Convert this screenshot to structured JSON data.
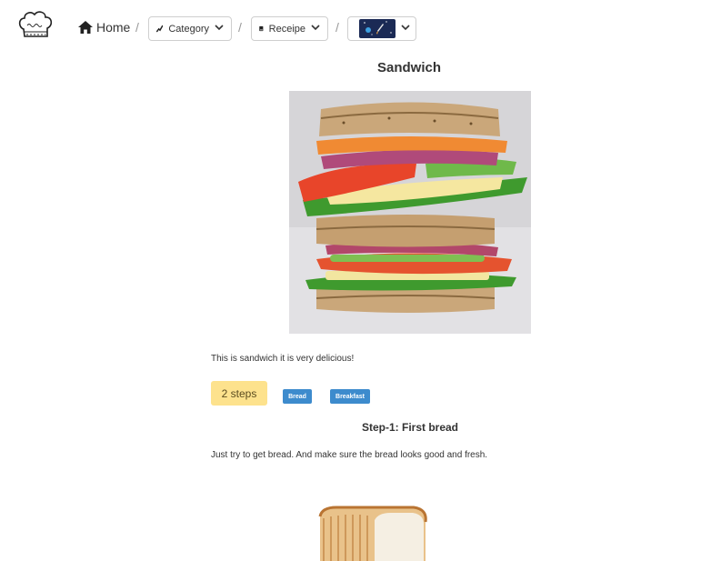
{
  "nav": {
    "home_label": "Home",
    "separator": "/",
    "category_label": "Category",
    "recipe_label": "Receipe"
  },
  "recipe": {
    "title": "Sandwich",
    "description": "This is sandwich it is very delicious!",
    "steps_badge": "2 steps",
    "tags": [
      "Bread",
      "Breakfast"
    ]
  },
  "step": {
    "title": "Step-1: First bread",
    "text": "Just try to get bread. And make sure the bread looks good and fresh."
  },
  "colors": {
    "steps_badge_bg": "#fde28d",
    "tag_bg": "#3d8bcd"
  },
  "icons": {
    "home": "home-icon",
    "category": "category-icon",
    "recipe": "book-icon",
    "chevron": "chevron-down-icon"
  }
}
